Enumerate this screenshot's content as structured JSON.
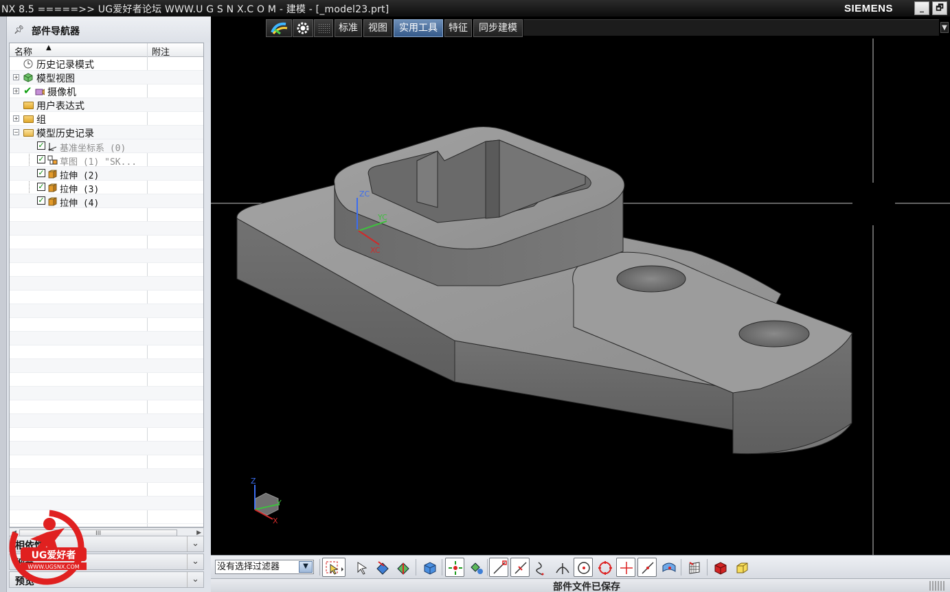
{
  "window": {
    "title": "NX 8.5  =====>>  UG爱好者论坛  WWW.U G S N X.C O M - 建模 - [_model23.prt]",
    "brand": "SIEMENS",
    "minimize_label": "_",
    "restore_label": "🗗"
  },
  "navigator": {
    "title": "部件导航器",
    "columns": {
      "name": "名称",
      "note": "附注"
    },
    "items": [
      {
        "label": "历史记录模式",
        "icon": "clock-icon",
        "expandable": false,
        "level": 0
      },
      {
        "label": "模型视图",
        "icon": "model-views-icon",
        "expandable": true,
        "level": 0
      },
      {
        "label": "摄像机",
        "icon": "camera-icon",
        "expandable": true,
        "level": 0,
        "checked": true
      },
      {
        "label": "用户表达式",
        "icon": "folder-icon",
        "expandable": false,
        "level": 0
      },
      {
        "label": "组",
        "icon": "folder-icon",
        "expandable": true,
        "level": 0
      },
      {
        "label": "模型历史记录",
        "icon": "folder-open-icon",
        "expandable": true,
        "expanded": true,
        "level": 0
      },
      {
        "label": "基准坐标系 (0)",
        "icon": "datum-csys-icon",
        "level": 1,
        "checked": true,
        "dimmed": true
      },
      {
        "label": "草图 (1) \"SK...",
        "icon": "sketch-icon",
        "level": 1,
        "checked": true,
        "dimmed": true
      },
      {
        "label": "拉伸 (2)",
        "icon": "extrude-icon",
        "level": 1,
        "checked": true
      },
      {
        "label": "拉伸 (3)",
        "icon": "extrude-icon",
        "level": 1,
        "checked": true
      },
      {
        "label": "拉伸 (4)",
        "icon": "extrude-icon",
        "level": 1,
        "checked": true
      }
    ],
    "sections": [
      {
        "label": "相依性"
      },
      {
        "label": "细节"
      },
      {
        "label": "预览"
      }
    ],
    "scroll_grip": "III"
  },
  "tabs": [
    {
      "label": "标准",
      "active": false
    },
    {
      "label": "视图",
      "active": false
    },
    {
      "label": "实用工具",
      "active": true
    },
    {
      "label": "特征",
      "active": false
    },
    {
      "label": "同步建模",
      "active": false
    }
  ],
  "viewport": {
    "wcs_labels": {
      "z": "ZC",
      "y": "YC",
      "x": "XC"
    },
    "triad_labels": {
      "z": "Z",
      "y": "Y",
      "x": "X"
    },
    "colors": {
      "background": "#000000",
      "body_top": "#9a9a9a",
      "body_side": "#6e6e6e",
      "edge": "#2a2a2a"
    }
  },
  "toolbar": {
    "filter_value": "没有选择过滤器",
    "tools": [
      "general-selection-icon",
      "select-feature-icon",
      "select-body-icon",
      "select-face-icon",
      "solid-body-icon",
      "snap-all-icon",
      "point-snap-icon",
      "end-point-icon",
      "mid-point-icon",
      "control-point-icon",
      "intersection-icon",
      "arc-center-icon",
      "quadrant-icon",
      "existing-point-icon",
      "point-on-curve-icon",
      "point-on-face-icon",
      "grid-icon",
      "view-cube-icon",
      "wireframe-box-icon"
    ]
  },
  "status": {
    "message": "部件文件已保存"
  },
  "watermark": {
    "brand": "UG爱好者",
    "url": "WWW.UGSNX.COM"
  }
}
